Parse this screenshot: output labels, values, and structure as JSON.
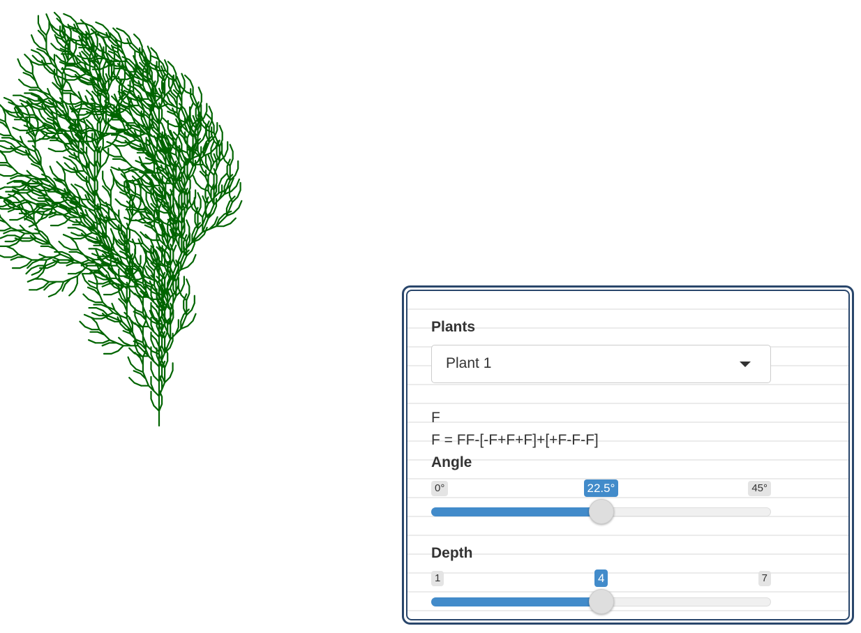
{
  "canvas": {
    "stroke_color": "#006400",
    "axiom": "F",
    "rule": "F = FF-[-F+F+F]+[+F-F-F]",
    "angle_deg": 22.5,
    "depth": 4
  },
  "panel": {
    "plants_label": "Plants",
    "plant_select": {
      "selected": "Plant 1"
    },
    "axiom_text": "F",
    "rule_text": "F = FF-[-F+F+F]+[+F-F-F]",
    "angle": {
      "label": "Angle",
      "min": 0,
      "max": 45,
      "value": 22.5,
      "min_label": "0°",
      "max_label": "45°",
      "value_label": "22.5°"
    },
    "depth": {
      "label": "Depth",
      "min": 1,
      "max": 7,
      "value": 4,
      "min_label": "1",
      "max_label": "7",
      "value_label": "4"
    }
  },
  "colors": {
    "panel_border": "#29466b",
    "slider_accent": "#428bca",
    "plant": "#006400"
  }
}
